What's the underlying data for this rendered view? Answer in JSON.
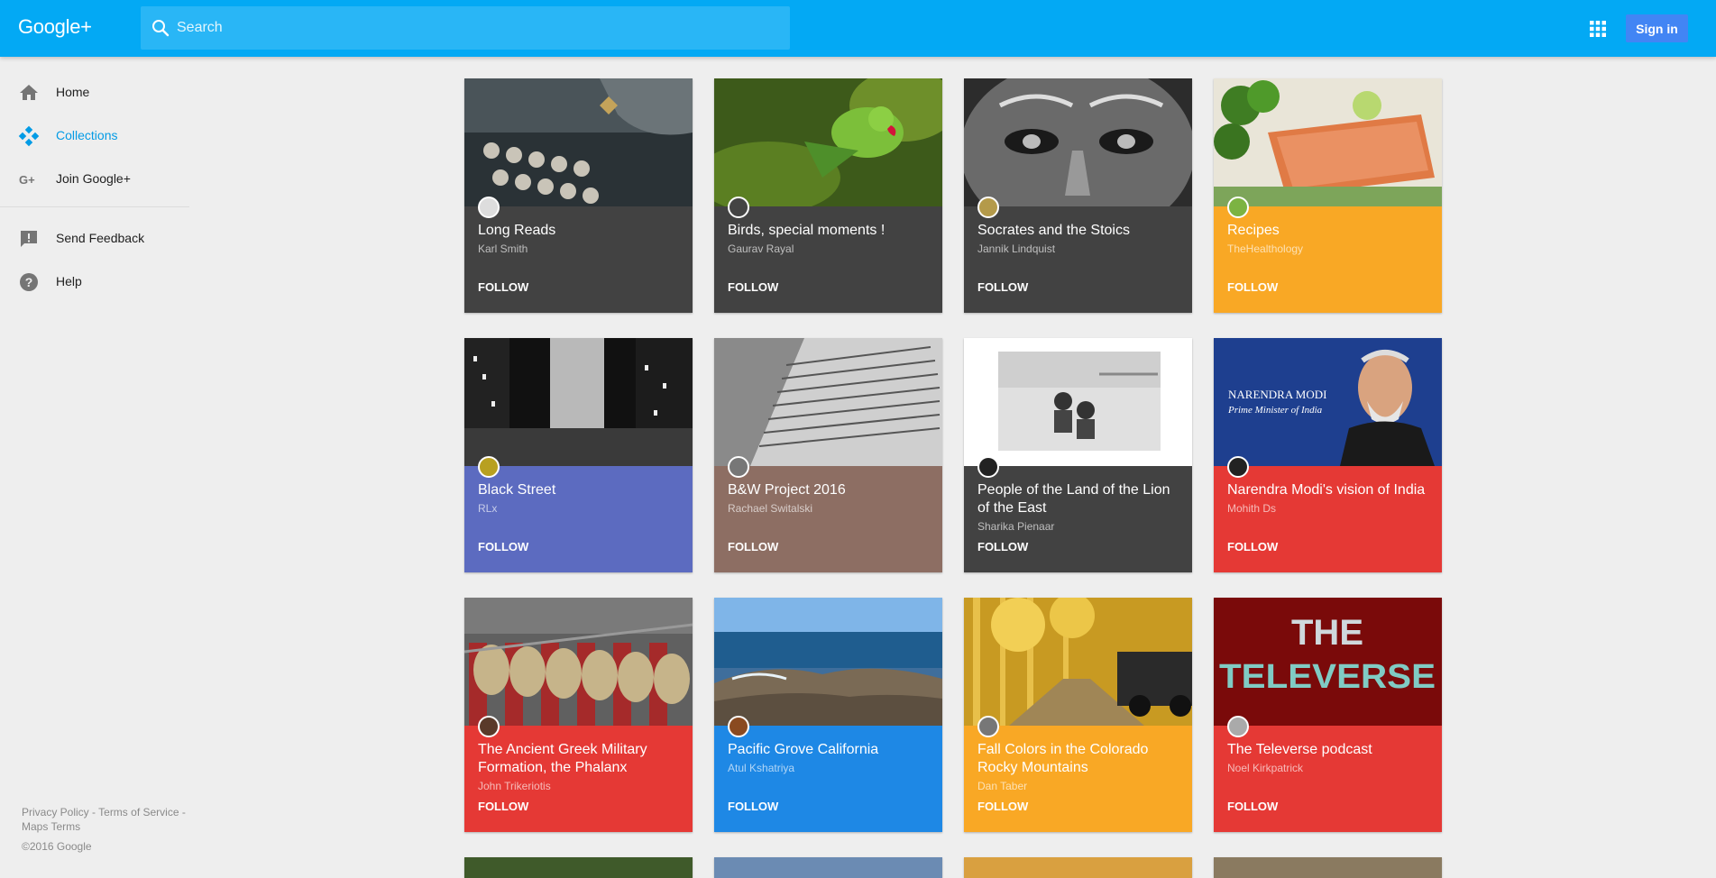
{
  "header": {
    "logo": "Google+",
    "search_placeholder": "Search",
    "signin_label": "Sign in",
    "apps_icon": "apps-grid-icon",
    "search_icon": "search-icon",
    "colors": {
      "bar": "#03a9f4",
      "search": "#29b6f6",
      "signin": "#4285f4"
    }
  },
  "sidebar": {
    "items": [
      {
        "label": "Home",
        "icon": "home-icon"
      },
      {
        "label": "Collections",
        "icon": "collections-icon"
      },
      {
        "label": "Join Google+",
        "icon": "google-plus-icon"
      },
      {
        "label": "Send Feedback",
        "icon": "feedback-icon"
      },
      {
        "label": "Help",
        "icon": "help-icon"
      }
    ],
    "active_color": "#039be5",
    "footer": {
      "privacy": "Privacy Policy",
      "sep1": " - ",
      "terms": "Terms of Service",
      "sep2": " - ",
      "maps": "Maps Terms",
      "copyright": "©2016 Google"
    }
  },
  "collections": [
    {
      "title": "Long Reads",
      "owner": "Karl Smith",
      "follow": "FOLLOW",
      "color": "#424242"
    },
    {
      "title": "Birds, special moments !",
      "owner": "Gaurav Rayal",
      "follow": "FOLLOW",
      "color": "#424242"
    },
    {
      "title": "Socrates and the Stoics",
      "owner": "Jannik Lindquist",
      "follow": "FOLLOW",
      "color": "#424242"
    },
    {
      "title": "Recipes",
      "owner": "TheHealthology",
      "follow": "FOLLOW",
      "color": "#f9a825"
    },
    {
      "title": "Black Street",
      "owner": "RLx",
      "follow": "FOLLOW",
      "color": "#5c6bc0"
    },
    {
      "title": "B&W Project 2016",
      "owner": "Rachael Switalski",
      "follow": "FOLLOW",
      "color": "#8d6e63"
    },
    {
      "title": "People of the Land of the Lion of the East",
      "owner": "Sharika Pienaar",
      "follow": "FOLLOW",
      "color": "#424242"
    },
    {
      "title": "Narendra Modi's vision of India",
      "owner": "Mohith Ds",
      "follow": "FOLLOW",
      "color": "#e53935"
    },
    {
      "title": "The Ancient Greek Military Formation, the Phalanx",
      "owner": "John Trikeriotis",
      "follow": "FOLLOW",
      "color": "#e53935"
    },
    {
      "title": "Pacific Grove California",
      "owner": "Atul Kshatriya",
      "follow": "FOLLOW",
      "color": "#1e88e5"
    },
    {
      "title": "Fall Colors in the Colorado Rocky Mountains",
      "owner": "Dan Taber",
      "follow": "FOLLOW",
      "color": "#f9a825"
    },
    {
      "title": "The Televerse podcast",
      "owner": "Noel Kirkpatrick",
      "follow": "FOLLOW",
      "color": "#e53935"
    }
  ],
  "image_text": {
    "modi_name": "NARENDRA MODI",
    "modi_role": "Prime Minister of India",
    "televerse_1": "THE",
    "televerse_2": "TELEVERSE"
  }
}
